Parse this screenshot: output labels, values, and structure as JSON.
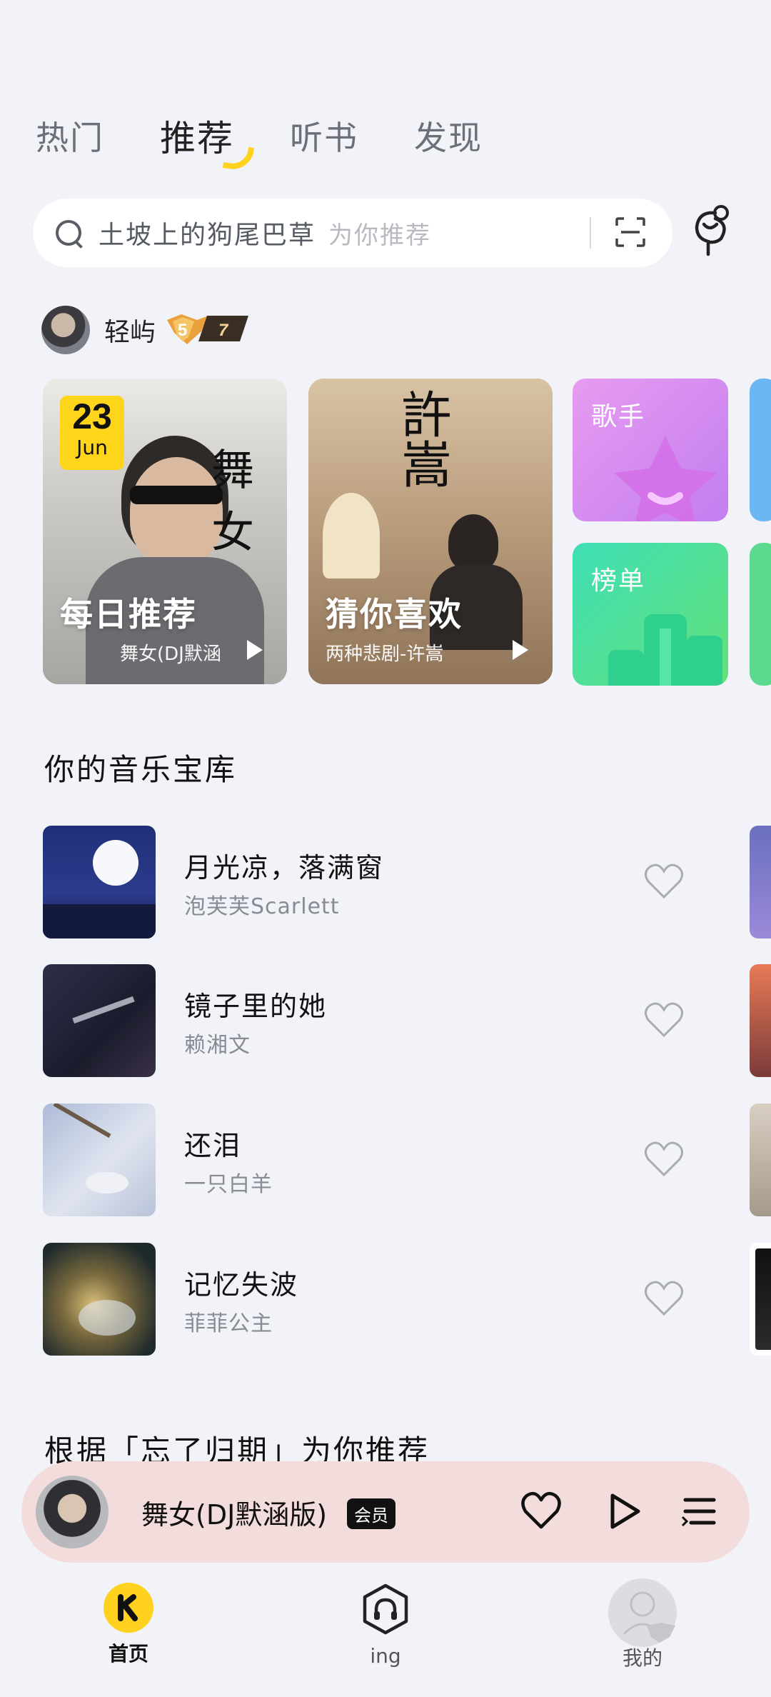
{
  "tabs": [
    {
      "label": "热门",
      "active": false
    },
    {
      "label": "推荐",
      "active": true
    },
    {
      "label": "听书",
      "active": false
    },
    {
      "label": "发现",
      "active": false
    }
  ],
  "search": {
    "query": "土坡上的狗尾巴草",
    "hint": "为你推荐"
  },
  "user": {
    "name": "轻屿",
    "level": "7",
    "vip_level": "5"
  },
  "cards": {
    "daily": {
      "day": "23",
      "month": "Jun",
      "title": "每日推荐",
      "subtitle": "舞女(DJ默涵",
      "art_text": "舞女"
    },
    "guess": {
      "title": "猜你喜欢",
      "subtitle": "两种悲剧-许嵩",
      "art_text": "許嵩"
    },
    "tiles": [
      {
        "label": "歌手",
        "color": "#d98af0"
      },
      {
        "label": "榜单",
        "color": "#4ddf9e"
      }
    ]
  },
  "library": {
    "title": "你的音乐宝库",
    "songs": [
      {
        "title": "月光凉，落满窗",
        "artist": "泡芙芙Scarlett"
      },
      {
        "title": "镜子里的她",
        "artist": "赖湘文"
      },
      {
        "title": "还泪",
        "artist": "一只白羊"
      },
      {
        "title": "记忆失波",
        "artist": "菲菲公主"
      }
    ]
  },
  "next_section": {
    "title": "根据「忘了归期」为你推荐"
  },
  "player": {
    "title": "舞女(DJ默涵版)",
    "badge": "会员"
  },
  "nav": [
    {
      "label": "首页",
      "icon": "kugou-home-icon",
      "active": true
    },
    {
      "label": "ing",
      "icon": "headphone-hexagon-icon",
      "active": false
    },
    {
      "label": "我的",
      "icon": "profile-avatar-icon",
      "active": false
    }
  ],
  "colors": {
    "accent": "#ffd21f",
    "background": "#f2f3f8",
    "player_bg": "#f2dcdc"
  }
}
